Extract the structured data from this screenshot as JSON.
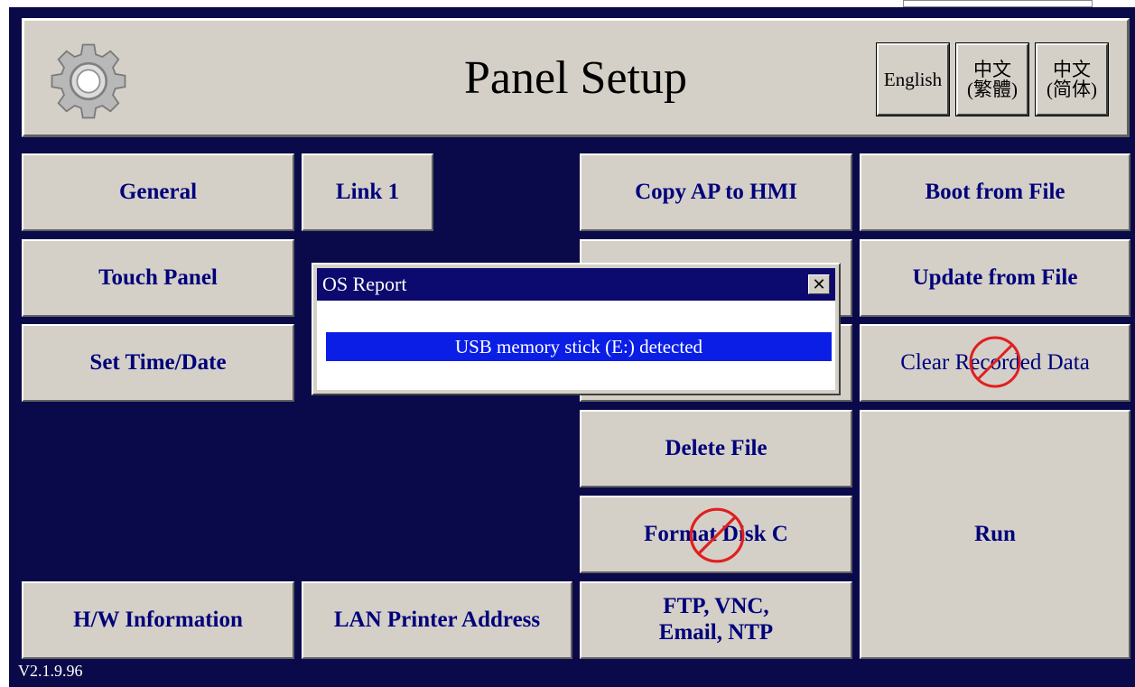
{
  "header": {
    "title": "Panel Setup",
    "languages": [
      {
        "label": "English"
      },
      {
        "line1": "中文",
        "line2": "(繁體)"
      },
      {
        "line1": "中文",
        "line2": "(简体)"
      }
    ]
  },
  "buttons": {
    "general": "General",
    "link1": "Link 1",
    "copy_ap": "Copy AP to HMI",
    "boot_from_file": "Boot from File",
    "touch_panel": "Touch Panel",
    "update_from_file": "Update from File",
    "set_time_date": "Set Time/Date",
    "clear_recorded_data": "Clear Recorded Data",
    "delete_file": "Delete File",
    "format_disk": "Format Disk C",
    "run": "Run",
    "hw_info": "H/W Information",
    "lan_printer": "LAN Printer Address",
    "ftp_line1": "FTP, VNC,",
    "ftp_line2": "Email, NTP"
  },
  "dialog": {
    "title": "OS Report",
    "close_glyph": "✕",
    "message": "USB memory stick (E:) detected"
  },
  "footer": {
    "version": "V2.1.9.96"
  },
  "colors": {
    "background": "#0a0a4a",
    "button_face": "#d4d0c8",
    "button_text": "#00007a",
    "dialog_titlebar": "#0c0a6e",
    "message_highlight": "#0a1ee6",
    "disabled_mark": "#e02020"
  },
  "icons": {
    "logo": "gear-icon",
    "disabled": "no-entry-icon"
  }
}
